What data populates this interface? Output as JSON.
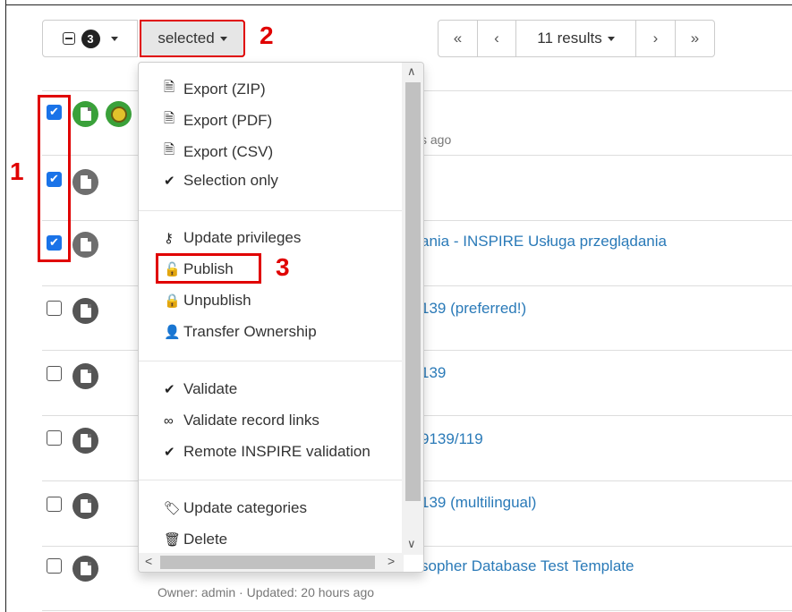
{
  "toolbar": {
    "selected_count": "3",
    "selected_label": "selected",
    "pager": {
      "first": "«",
      "prev": "‹",
      "results": "11 results",
      "next": "›",
      "last": "»"
    }
  },
  "annotations": {
    "a1": "1",
    "a2": "2",
    "a3": "3"
  },
  "rows": [
    {
      "checked": true,
      "title": "",
      "meta": "s ago"
    },
    {
      "checked": true,
      "title": "",
      "meta": ""
    },
    {
      "checked": true,
      "title": "ania - INSPIRE Usługa przeglądania",
      "meta": ""
    },
    {
      "checked": false,
      "title": "139 (preferred!)",
      "meta": ""
    },
    {
      "checked": false,
      "title": "139",
      "meta": ""
    },
    {
      "checked": false,
      "title": "9139/119",
      "meta": ""
    },
    {
      "checked": false,
      "title": "139 (multilingual)",
      "meta": ""
    },
    {
      "checked": false,
      "title": "sopher Database Test Template",
      "meta": "Owner: admin · Updated: 20 hours ago"
    }
  ],
  "menu": {
    "export_zip": "Export (ZIP)",
    "export_pdf": "Export (PDF)",
    "export_csv": "Export (CSV)",
    "selection_only": "Selection only",
    "update_privileges": "Update privileges",
    "publish": "Publish",
    "unpublish": "Unpublish",
    "transfer_ownership": "Transfer Ownership",
    "validate": "Validate",
    "validate_links": "Validate record links",
    "remote_inspire": "Remote INSPIRE validation",
    "update_categories": "Update categories",
    "delete": "Delete"
  },
  "colors": {
    "annotation": "#e00000",
    "link": "#2a7ab8",
    "check": "#1a73e8"
  }
}
